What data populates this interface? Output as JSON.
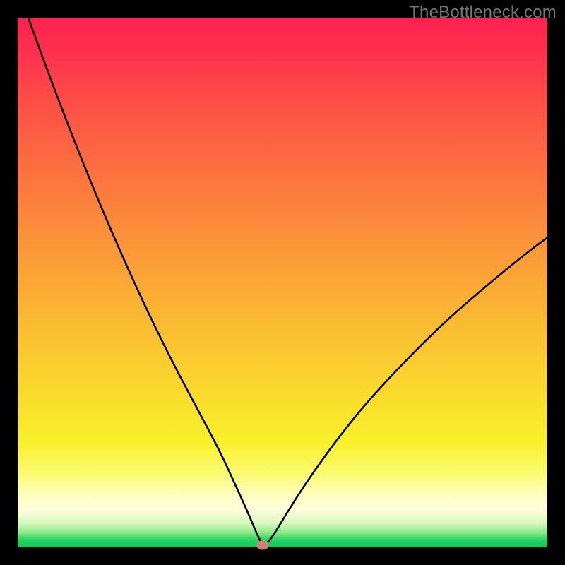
{
  "watermark": "TheBottleneck.com",
  "chart_data": {
    "type": "line",
    "title": "",
    "xlabel": "",
    "ylabel": "",
    "xlim": [
      0,
      100
    ],
    "ylim": [
      0,
      100
    ],
    "grid": false,
    "legend": false,
    "background": "red-yellow-green vertical gradient",
    "series": [
      {
        "name": "bottleneck-curve",
        "x": [
          2.0,
          6.0,
          10.0,
          14.0,
          18.0,
          22.0,
          26.0,
          30.0,
          34.0,
          38.0,
          41.0,
          43.5,
          45.3,
          46.3,
          47.0,
          48.5,
          51.0,
          55.0,
          60.0,
          66.0,
          73.0,
          80.0,
          88.0,
          96.0,
          100.0
        ],
        "y": [
          100.0,
          89.0,
          78.5,
          68.5,
          59.0,
          50.0,
          41.5,
          33.5,
          26.0,
          18.5,
          12.0,
          6.5,
          2.2,
          0.4,
          0.6,
          2.6,
          6.8,
          13.0,
          20.0,
          27.5,
          35.0,
          42.0,
          49.0,
          55.5,
          58.5
        ]
      }
    ],
    "marker": {
      "name": "optimal-point",
      "x": 46.3,
      "y": 0.4,
      "color": "#cf8176"
    }
  },
  "colors": {
    "marker": "#cf8176",
    "curve": "#000000",
    "frame": "#000000"
  }
}
